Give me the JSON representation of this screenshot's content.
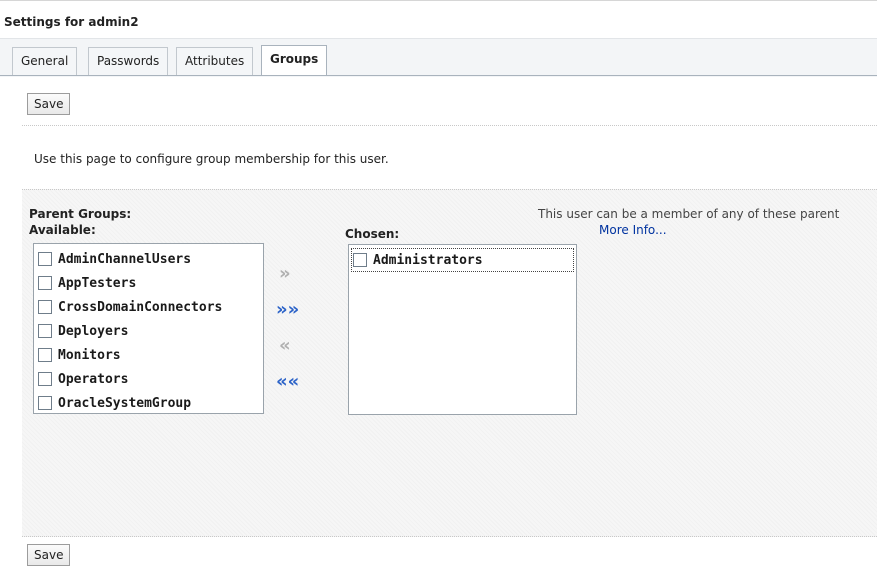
{
  "page": {
    "title": "Settings for admin2"
  },
  "tabs": [
    {
      "label": "General"
    },
    {
      "label": "Passwords"
    },
    {
      "label": "Attributes"
    },
    {
      "label": "Groups",
      "active": true
    }
  ],
  "actions": {
    "save_label": "Save"
  },
  "description": "Use this page to configure group membership for this user.",
  "groups": {
    "parent_groups_label": "Parent Groups:",
    "available_label": "Available:",
    "chosen_label": "Chosen:",
    "hint": "This user can be a member of any of these parent",
    "more_info": "More Info...",
    "available": [
      "AdminChannelUsers",
      "AppTesters",
      "CrossDomainConnectors",
      "Deployers",
      "Monitors",
      "Operators",
      "OracleSystemGroup"
    ],
    "chosen": [
      "Administrators"
    ]
  },
  "shuttle": {
    "move": "»",
    "move_all": "»»",
    "remove": "«",
    "remove_all": "««"
  },
  "colors": {
    "accent": "#2c63c8",
    "link": "#0033a0",
    "panel_bg": "#f6f6f6"
  }
}
